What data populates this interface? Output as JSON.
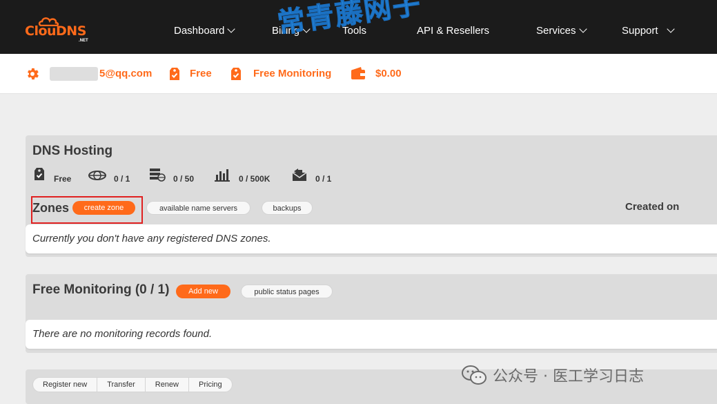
{
  "logo": {
    "text": "ClouDNS",
    "sub": ".NET"
  },
  "nav": {
    "dashboard": "Dashboard",
    "billing": "Billing",
    "tools": "Tools",
    "api": "API & Resellers",
    "services": "Services",
    "support": "Support"
  },
  "overlay_watermark": "常青藤网子",
  "account": {
    "email_visible": "5@qq.com",
    "plan": "Free",
    "monitoring": "Free Monitoring",
    "balance": "$0.00"
  },
  "dns_hosting": {
    "title": "DNS Hosting",
    "stats": {
      "plan": "Free",
      "zones": "0 / 1",
      "records": "0 / 50",
      "queries": "0 / 500K",
      "mail_forwards": "0 / 1"
    },
    "zones_label": "Zones",
    "create_zone": "create zone",
    "available_ns": "available name servers",
    "backups": "backups",
    "created_on": "Created on",
    "empty_message": "Currently you don't have any registered DNS zones."
  },
  "monitoring": {
    "title": "Free Monitoring (0 / 1)",
    "add_new": "Add new",
    "public_status": "public status pages",
    "empty_message": "There are no monitoring records found."
  },
  "domains": {
    "register_new": "Register new",
    "transfer": "Transfer",
    "renew": "Renew",
    "pricing": "Pricing"
  },
  "footer_watermark": "公众号 · 医工学习日志",
  "colors": {
    "accent": "#ff6a1a",
    "nav_bg": "#1b1b1b",
    "highlight": "#e02020"
  }
}
